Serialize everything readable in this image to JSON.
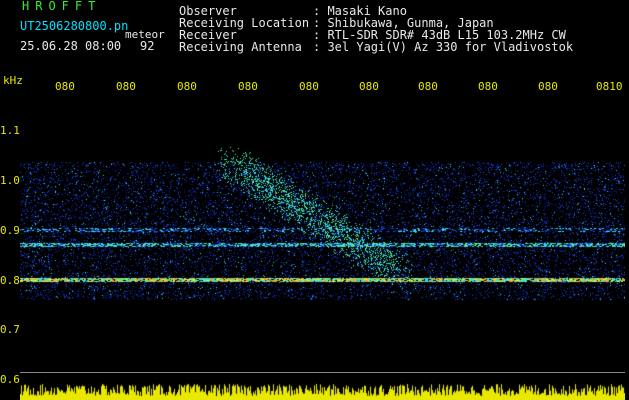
{
  "header": {
    "title": "HROFFT",
    "file": "UT2506280800.pn",
    "meteor_label": "meteor",
    "datetime": "25.06.28 08:00",
    "count": "92",
    "meta": [
      {
        "key": "Observer",
        "value": ": Masaki Kano"
      },
      {
        "key": "Receiving Location",
        "value": ": Shibukawa, Gunma, Japan"
      },
      {
        "key": "Receiver",
        "value": ": RTL-SDR SDR# 43dB L15 103.2MHz CW"
      },
      {
        "key": "Receiving Antenna",
        "value": ": 3el Yagi(V) Az 330 for Vladivostok"
      }
    ]
  },
  "axis": {
    "unit": "kHz",
    "time_ticks": [
      "080",
      "080",
      "080",
      "080",
      "080",
      "080",
      "080",
      "080",
      "080",
      "0810"
    ],
    "freq_ticks": [
      "1.1",
      "1.0",
      "0.9",
      "0.8",
      "0.7",
      "0.6"
    ]
  },
  "colors": {
    "background": "#000000",
    "noise_deep": "#0a1a8a",
    "noise_mid": "#1e4adf",
    "signal_cyan": "#33ddee",
    "signal_green": "#55ee88",
    "signal_yellow": "#e8e840",
    "signal_orange": "#ff9922",
    "power_bar": "#e8e800"
  }
}
